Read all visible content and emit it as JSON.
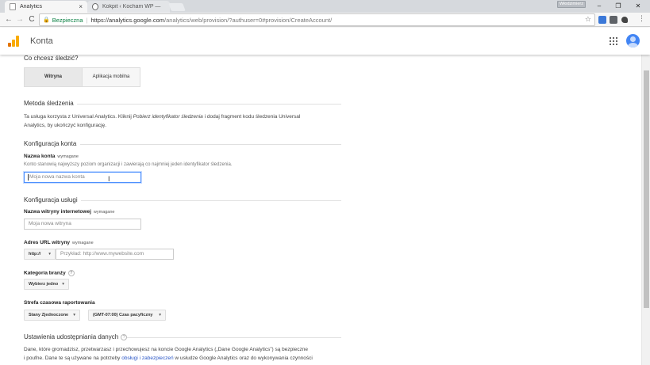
{
  "browser": {
    "tabs": [
      {
        "title": "Analytics",
        "close": "×"
      },
      {
        "title": "Kokpit ‹ Kocham WP — ",
        "close": ""
      }
    ],
    "profile_label": "Włodzimierz",
    "window_controls": {
      "minimize": "–",
      "maximize": "❐",
      "close": "✕"
    },
    "nav": {
      "back": "←",
      "forward": "→",
      "reload": "C"
    },
    "address": {
      "secure_label": "Bezpieczna",
      "url_host": "https://analytics.google.com",
      "url_path": "/analytics/web/provision/?authuser=0#provision/CreateAccount/"
    }
  },
  "header": {
    "title": "Konta"
  },
  "form": {
    "track_question": "Co chcesz śledzić?",
    "track_options": [
      "Witryna",
      "Aplikacja mobilna"
    ],
    "method": {
      "title": "Metoda śledzenia",
      "desc_1": "Ta usługa korzysta z Universal Analytics. Kliknij ",
      "desc_em": "Pobierz identyfikator śledzenia",
      "desc_2": " i dodaj fragment kodu śledzenia Universal",
      "desc_3": "Analytics, by ukończyć konfigurację."
    },
    "account": {
      "title": "Konfiguracja konta",
      "name_label": "Nazwa konta",
      "required": "wymagane",
      "name_hint": "Konto stanowią najwyższy poziom organizacji i zawierają co najmniej jeden identyfikator śledzenia.",
      "name_placeholder": "Moja nowa nazwa konta"
    },
    "property": {
      "title": "Konfiguracja usługi",
      "site_name_label": "Nazwa witryny internetowej",
      "required": "wymagane",
      "site_name_placeholder": "Moja nowa witryna",
      "url_label": "Adres URL witryny",
      "protocol": "http://",
      "url_placeholder": "Przykład: http://www.mywebsite.com",
      "industry_label": "Kategoria branży",
      "industry_value": "Wybierz jedno",
      "timezone_label": "Strefa czasowa raportowania",
      "country_value": "Stany Zjednoczone",
      "timezone_value": "(GMT-07:00) Czas pacyficzny",
      "help": "?"
    },
    "sharing": {
      "title": "Ustawienia udostępniania danych",
      "text_1": "Dane, które gromadzisz, przetwarzasz i przechowujesz na koncie Google Analytics („Dane Google Analytics”) są bezpieczne",
      "text_2a": "i poufne. Dane te są używane na potrzeby ",
      "link": "obsługi i zabezpieczeń",
      "text_2b": " w usłudze Google Analytics oraz do wykonywania czynności"
    }
  }
}
